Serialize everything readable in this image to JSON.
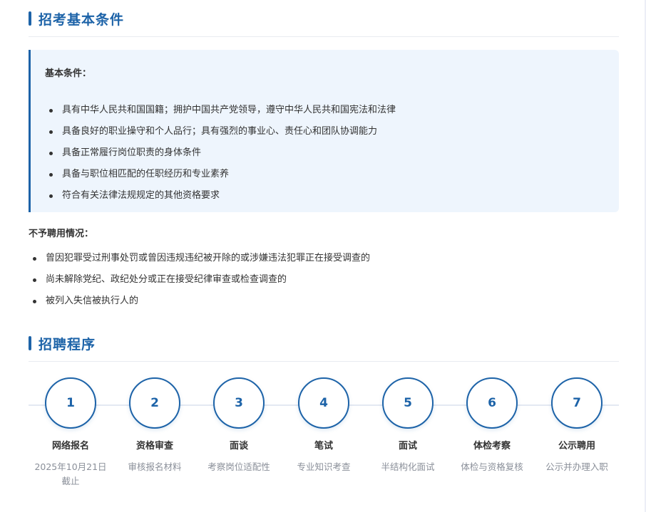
{
  "basic_conditions_section": {
    "title": "招考基本条件",
    "box_title": "基本条件：",
    "items": [
      "具有中华人民共和国国籍；拥护中国共产党领导，遵守中华人民共和国宪法和法律",
      "具备良好的职业操守和个人品行；具有强烈的事业心、责任心和团队协调能力",
      "具备正常履行岗位职责的身体条件",
      "具备与职位相匹配的任职经历和专业素养",
      "符合有关法律法规规定的其他资格要求"
    ]
  },
  "exclusions": {
    "title": "不予聘用情况：",
    "items": [
      "曾因犯罪受过刑事处罚或曾因违规违纪被开除的或涉嫌违法犯罪正在接受调查的",
      "尚未解除党纪、政纪处分或正在接受纪律审查或检查调查的",
      "被列入失信被执行人的"
    ]
  },
  "process_section": {
    "title": "招聘程序",
    "steps": [
      {
        "number": "1",
        "name": "网络报名",
        "desc": "2025年10月21日截止"
      },
      {
        "number": "2",
        "name": "资格审查",
        "desc": "审核报名材料"
      },
      {
        "number": "3",
        "name": "面谈",
        "desc": "考察岗位适配性"
      },
      {
        "number": "4",
        "name": "笔试",
        "desc": "专业知识考查"
      },
      {
        "number": "5",
        "name": "面试",
        "desc": "半结构化面试"
      },
      {
        "number": "6",
        "name": "体检考察",
        "desc": "体检与资格复核"
      },
      {
        "number": "7",
        "name": "公示聘用",
        "desc": "公示并办理入职"
      }
    ]
  },
  "colors": {
    "accent": "#1d63a8",
    "box_background": "#eef5fd",
    "muted_text": "#8a8f99"
  }
}
